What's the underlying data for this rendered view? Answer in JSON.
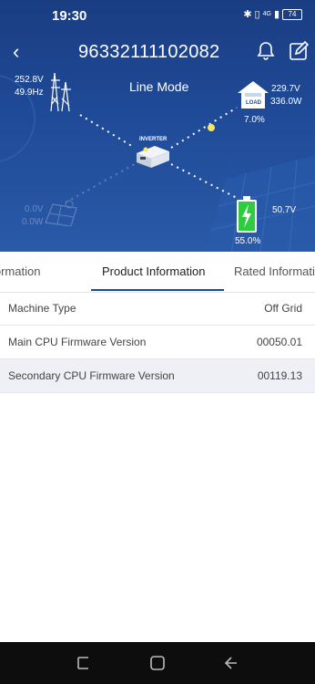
{
  "status_bar": {
    "time": "19:30",
    "network": "4G",
    "battery": "74"
  },
  "header": {
    "device_id": "96332111102082",
    "mode": "Line Mode"
  },
  "flow": {
    "grid": {
      "voltage": "252.8V",
      "frequency": "49.9Hz"
    },
    "load": {
      "voltage": "229.7V",
      "power": "336.0W",
      "percent": "7.0%",
      "icon_label": "LOAD"
    },
    "inverter": {
      "label": "INVERTER"
    },
    "pv": {
      "voltage": "0.0V",
      "power": "0.0W"
    },
    "battery": {
      "voltage": "50.7V",
      "percent": "55.0%",
      "charge_level": 0.55
    }
  },
  "tabs": [
    {
      "label": "Basic Information"
    },
    {
      "label": "Product Information"
    },
    {
      "label": "Rated Information"
    }
  ],
  "product_info": [
    {
      "key": "Machine Type",
      "value": "Off Grid"
    },
    {
      "key": "Main CPU Firmware Version",
      "value": "00050.01"
    },
    {
      "key": "Secondary CPU Firmware Version",
      "value": "00119.13"
    }
  ],
  "colors": {
    "header_bg": "#1f4a97",
    "battery_green": "#2ecc40",
    "active_tab_underline": "#1c4b8f",
    "flow_dot": "#f5e663"
  }
}
